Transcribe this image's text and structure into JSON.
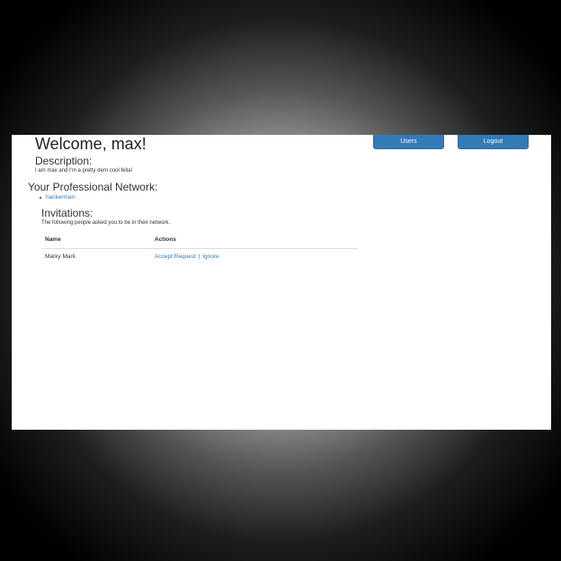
{
  "header": {
    "welcome": "Welcome, max!",
    "users_button": "Users",
    "logout_button": "Logout"
  },
  "description": {
    "title": "Description:",
    "text": "I am max and I'm a pretty dern cool fella!"
  },
  "network": {
    "title": "Your Professional Network:",
    "items": [
      {
        "label": "hackerman"
      }
    ]
  },
  "invitations": {
    "title": "Invitations:",
    "text": "The following people asked you to be in their network.",
    "columns": [
      "Name",
      "Actions"
    ],
    "rows": [
      {
        "name": "Marky Mark",
        "accept": "Accept Request",
        "separator": "|",
        "ignore": "Ignore"
      }
    ]
  },
  "colors": {
    "button": "#337ab7",
    "link": "#337ab7"
  }
}
